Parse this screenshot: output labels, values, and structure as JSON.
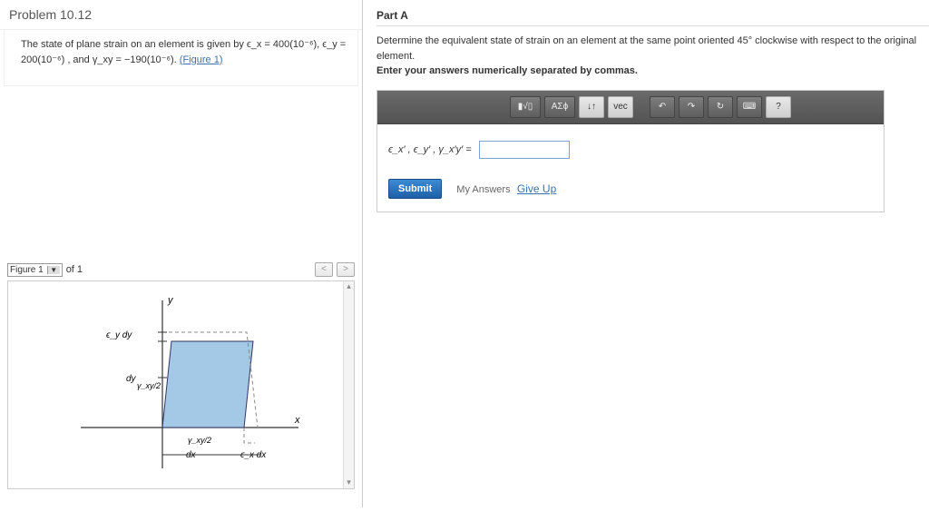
{
  "problem": {
    "title": "Problem 10.12",
    "text_prefix": "The state of plane strain on an element is given by ",
    "ex_label": "ϵ_x = 400(10⁻⁶)",
    "ey_label": "ϵ_y = 200(10⁻⁶)",
    "and_label": ", and ",
    "gamma_label": "γ_xy = −190(10⁻⁶)",
    "figure_link": "(Figure 1)",
    "comma": ", "
  },
  "figure": {
    "selector_label": "Figure 1",
    "of_label": "of 1",
    "labels": {
      "y": "y",
      "x": "x",
      "eydy": "ϵ_y dy",
      "dy": "dy",
      "gxy2a": "γ_xy/2",
      "gxy2b": "γ_xy/2",
      "dx": "dx",
      "exdx": "ϵ_x dx"
    }
  },
  "partA": {
    "heading": "Part A",
    "instruction1": "Determine the equivalent state of strain on an element at the same point oriented 45° clockwise with respect to the original element.",
    "instruction2": "Enter your answers numerically separated by commas.",
    "answer_label": "ϵ_x′ , ϵ_y′ , γ_x′y′  =",
    "submit": "Submit",
    "my_answers": "My Answers",
    "give_up": "Give Up",
    "toolbar": {
      "templates": "▮√▯",
      "greek": "ΑΣϕ",
      "updown": "↓↑",
      "vec": "vec",
      "undo": "↶",
      "redo": "↷",
      "reset": "↻",
      "keyboard": "⌨",
      "help": "?"
    }
  }
}
